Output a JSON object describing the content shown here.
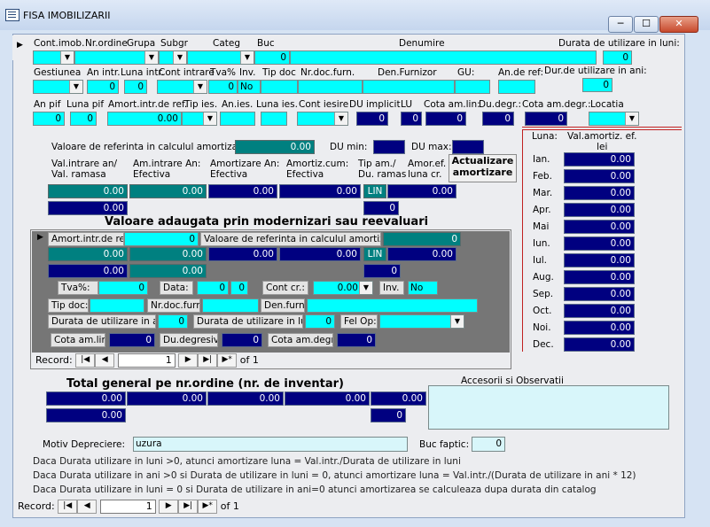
{
  "window": {
    "title": "FISA IMOBILIZARII",
    "min": "─",
    "max": "☐",
    "close": "✕"
  },
  "row1": {
    "labels": [
      "Cont.imob.",
      "Nr.ordine",
      "Grupa",
      "Subgr",
      "Categ",
      "Buc",
      "Denumire",
      "Durata de utilizare in luni:"
    ],
    "buc": "0",
    "durata_luni": "0"
  },
  "row2": {
    "labels": [
      "Gestiunea",
      "An intr.",
      "Luna intr.",
      "Cont intrare",
      "Tva%",
      "Inv.",
      "Tip doc",
      "Nr.doc.furn.",
      "Den.Furnizor",
      "GU:",
      "An.de ref:",
      "Dur.de utilizare in ani:"
    ],
    "an_intr": "0",
    "luna_intr": "0",
    "tva": "0",
    "inv": "No",
    "durata_ani": "0"
  },
  "row3": {
    "labels": [
      "An pif",
      "Luna pif",
      "Amort.intr.de ref.",
      "Tip ies.",
      "An.ies.",
      "Luna ies.",
      "Cont iesire",
      "DU implicit",
      "LU",
      "Cota am.lin:",
      "Du.degr.:",
      "Cota am.degr.:",
      "Locatia"
    ],
    "an_pif": "0",
    "luna_pif": "0",
    "amort": "0.00",
    "du_implicit": "0",
    "lu": "0",
    "cota_lin": "0",
    "du_degr": "0",
    "cota_degr": "0"
  },
  "ref": {
    "label": "Valoare de referinta in calculul amortizarii:",
    "value": "0.00",
    "du_min": "DU min:",
    "du_max": "DU max:"
  },
  "heads": [
    "Val.intrare an/\nVal. ramasa",
    "Am.intrare An:\nEfectiva",
    "Amortizare An:\nEfectiva",
    "Amortiz.cum:\nEfectiva",
    "Tip am./\nDu. ramas",
    "Amor.ef.\nluna cr."
  ],
  "actualize_label": "Actualizare amortizare",
  "vals": {
    "v1": "0.00",
    "v2": "0.00",
    "v3": "0.00",
    "v4": "0.00",
    "tip": "LIN",
    "v6": "0.00",
    "v7": "0.00",
    "du": "0"
  },
  "modern": {
    "title": "Valoare adaugata prin modernizari sau reevaluari",
    "amort_label": "Amort.intr.de ref.",
    "amort_val": "0",
    "ref_label": "Valoare de referinta in calculul amortizarii:",
    "ref_val": "0",
    "r2": [
      "0.00",
      "0.00",
      "0.00",
      "0.00",
      "LIN",
      "0.00"
    ],
    "r3": [
      "0.00",
      "0.00",
      "0"
    ],
    "tva_label": "Tva%:",
    "tva": "0",
    "data_label": "Data:",
    "data1": "0",
    "data2": "0",
    "contcr_label": "Cont cr.:",
    "contcr": "0.00",
    "inv_label": "Inv.",
    "inv": "No",
    "tipdoc_label": "Tip doc:",
    "nrdoc_label": "Nr.doc.furn:",
    "denfurn_label": "Den.furn:",
    "dur_ani_label": "Durata de utilizare in ani:",
    "dur_ani": "0",
    "dur_luni_label": "Durata de utilizare in luni:",
    "dur_luni": "0",
    "felop_label": "Fel Op:",
    "cota_lin_label": "Cota am.lin.:",
    "cota_lin": "0",
    "du_degr_label": "Du.degresiv:",
    "du_degr": "0",
    "cota_degr_label": "Cota am.degr.:",
    "cota_degr": "0",
    "record_label": "Record:",
    "record": "1",
    "of": "of",
    "total": "1"
  },
  "months": {
    "head1": "Luna:",
    "head2": "Val.amortiz. ef.\nlei",
    "names": [
      "Ian.",
      "Feb.",
      "Mar.",
      "Apr.",
      "Mai",
      "Iun.",
      "Iul.",
      "Aug.",
      "Sep.",
      "Oct.",
      "Noi.",
      "Dec."
    ],
    "values": [
      "0.00",
      "0.00",
      "0.00",
      "0.00",
      "0.00",
      "0.00",
      "0.00",
      "0.00",
      "0.00",
      "0.00",
      "0.00",
      "0.00"
    ]
  },
  "total": {
    "title": "Total general pe nr.ordine (nr. de inventar)",
    "r1": [
      "0.00",
      "0.00",
      "0.00",
      "0.00",
      "0.00"
    ],
    "r2": [
      "0.00",
      "0"
    ]
  },
  "obs_label": "Accesorii si Observatii",
  "motiv_label": "Motiv Depreciere:",
  "motiv": "uzura",
  "buc_faptic_label": "Buc faptic:",
  "buc_faptic": "0",
  "notes": [
    "Daca Durata utilizare in luni  >0, atunci amortizare luna = Val.intr./Durata de utilizare in luni",
    "Daca Durata utilizare in ani  >0 si Durata de utilizare in luni = 0, atunci amortizare luna = Val.intr./(Durata de utilizare in ani * 12)",
    "Daca Durata utilizare in luni = 0  si Durata de utilizare in ani=0 atunci amortizarea se calculeaza dupa durata din catalog"
  ],
  "bottom_nav": {
    "label": "Record:",
    "record": "1",
    "of": "of",
    "total": "1"
  }
}
